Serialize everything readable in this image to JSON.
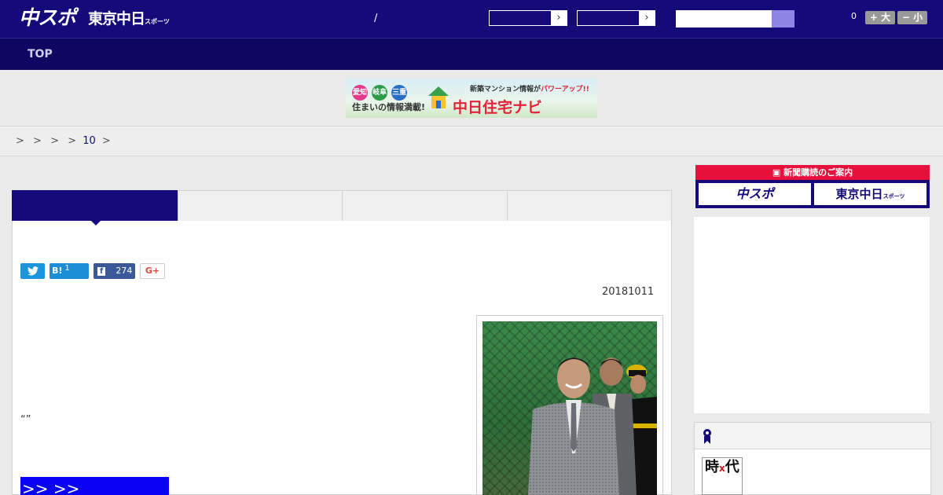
{
  "header": {
    "logo_primary": "中スポ",
    "logo_secondary": "東京中日",
    "logo_secondary_small": "スポーツ",
    "slash": "/",
    "select1_arrow": "›",
    "select2_arrow": "›",
    "search_placeholder": "",
    "font_count": "0",
    "font_larger": "+ 大",
    "font_smaller": "− 小"
  },
  "nav": {
    "top_label": "TOP"
  },
  "banner": {
    "pref1": "愛知",
    "pref2": "岐阜",
    "pref3": "三重",
    "subtitle": "住まいの情報満載!",
    "tagline_a": "新築マンション情報が",
    "tagline_b": "パワーアップ!!",
    "brand": "中日住宅ナビ"
  },
  "breadcrumb": {
    "sep": ">",
    "link": "10"
  },
  "article": {
    "date": "20181011",
    "quote": "“”",
    "link_text": ">> >>",
    "share": {
      "twitter_icon": "twitter-icon",
      "hatena_label": "B!",
      "hatena_count": "1",
      "facebook_label": "f",
      "facebook_count": "274",
      "gplus_label": "G+"
    }
  },
  "sidebar": {
    "subscribe_title": "新聞購読のご案内",
    "sub_chuspo": "中スポ",
    "sub_tokyo": "東京中日",
    "sub_tokyo_small": "スポーツ",
    "book_text": "時",
    "book_red": "x",
    "book_text2": "代"
  },
  "colors": {
    "brand_navy": "#150a7a",
    "nav_dark": "#0d0761",
    "subscribe_red": "#e8103c",
    "link_blue": "#0a00f5"
  }
}
